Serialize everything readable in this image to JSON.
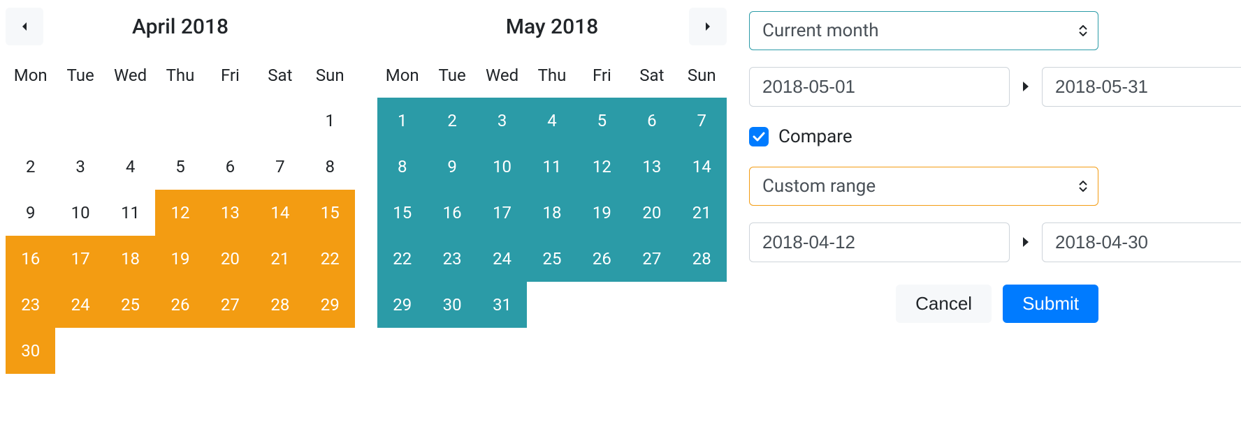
{
  "weekdays": [
    "Mon",
    "Tue",
    "Wed",
    "Thu",
    "Fri",
    "Sat",
    "Sun"
  ],
  "calendars": [
    {
      "title": "April 2018",
      "showPrev": true,
      "showNext": false,
      "leading_blanks": 6,
      "days": 30,
      "selection": {
        "type": "compare",
        "start": 12,
        "end": 30
      }
    },
    {
      "title": "May 2018",
      "showPrev": false,
      "showNext": true,
      "leading_blanks": 0,
      "days": 31,
      "selection": {
        "type": "primary",
        "start": 1,
        "end": 31
      }
    }
  ],
  "sidebar": {
    "primary_preset": "Current month",
    "primary_start": "2018-05-01",
    "primary_end": "2018-05-31",
    "compare_label": "Compare",
    "compare_checked": true,
    "compare_preset": "Custom range",
    "compare_start": "2018-04-12",
    "compare_end": "2018-04-30",
    "cancel": "Cancel",
    "submit": "Submit"
  },
  "colors": {
    "primary_sel": "#2b9ba7",
    "compare_sel": "#f39c12",
    "accent_blue": "#007bff"
  }
}
